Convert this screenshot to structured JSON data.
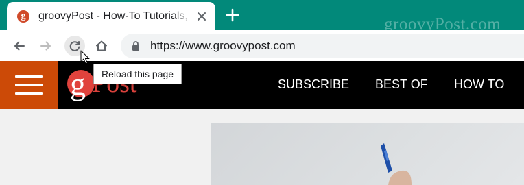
{
  "browser": {
    "tab": {
      "title": "groovyPost - How-To Tutorials, Re",
      "favicon_letter": "g"
    },
    "watermark": "groovyPost.com",
    "address_bar": {
      "url": "https://www.groovypost.com"
    },
    "tooltip": "Reload this page",
    "icons": [
      "back-icon",
      "forward-icon",
      "reload-icon",
      "home-icon",
      "lock-icon",
      "close-icon",
      "plus-icon",
      "cursor-icon"
    ]
  },
  "site": {
    "logo": {
      "letter": "g",
      "text": "Post"
    },
    "menu": [
      {
        "label": "SUBSCRIBE"
      },
      {
        "label": "BEST OF"
      },
      {
        "label": "HOW TO"
      }
    ]
  },
  "colors": {
    "tab_strip": "#02897a",
    "hamburger_bg": "#cc4a07",
    "nav_bg": "#000000",
    "logo_red": "#d9413b"
  }
}
